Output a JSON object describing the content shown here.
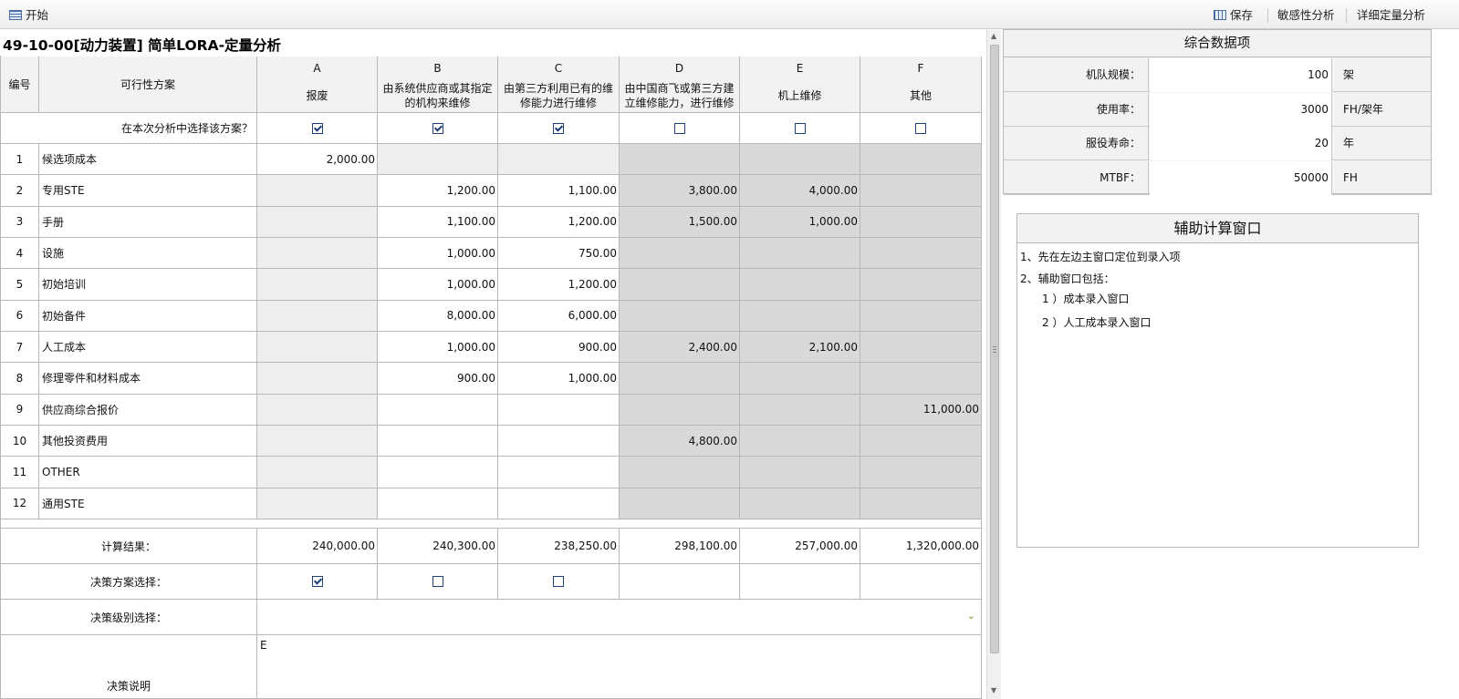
{
  "toolbar": {
    "start_label": "开始",
    "save_label": "保存",
    "sensitivity_label": "敏感性分析",
    "detail_label": "详细定量分析"
  },
  "page_title": "49-10-00[动力装置] 简单LORA-定量分析",
  "table": {
    "col_no_header": "编号",
    "col_option_header": "可行性方案",
    "columns": [
      {
        "letter": "A",
        "desc": "报废"
      },
      {
        "letter": "B",
        "desc": "由系统供应商或其指定的机构来维修"
      },
      {
        "letter": "C",
        "desc": "由第三方利用已有的维修能力进行维修"
      },
      {
        "letter": "D",
        "desc": "由中国商飞或第三方建立维修能力，进行维修"
      },
      {
        "letter": "E",
        "desc": "机上维修"
      },
      {
        "letter": "F",
        "desc": "其他"
      }
    ],
    "select_question": "在本次分析中选择该方案？",
    "select_checked": [
      true,
      true,
      true,
      false,
      false,
      false
    ],
    "rows": [
      {
        "no": "1",
        "name": "候选项成本",
        "values": [
          "2,000.00",
          "",
          "",
          "",
          "",
          ""
        ]
      },
      {
        "no": "2",
        "name": "专用STE",
        "values": [
          "",
          "1,200.00",
          "1,100.00",
          "3,800.00",
          "4,000.00",
          ""
        ]
      },
      {
        "no": "3",
        "name": "手册",
        "values": [
          "",
          "1,100.00",
          "1,200.00",
          "1,500.00",
          "1,000.00",
          ""
        ]
      },
      {
        "no": "4",
        "name": "设施",
        "values": [
          "",
          "1,000.00",
          "750.00",
          "",
          "",
          ""
        ]
      },
      {
        "no": "5",
        "name": "初始培训",
        "values": [
          "",
          "1,000.00",
          "1,200.00",
          "",
          "",
          ""
        ]
      },
      {
        "no": "6",
        "name": "初始备件",
        "values": [
          "",
          "8,000.00",
          "6,000.00",
          "",
          "",
          ""
        ]
      },
      {
        "no": "7",
        "name": "人工成本",
        "values": [
          "",
          "1,000.00",
          "900.00",
          "2,400.00",
          "2,100.00",
          ""
        ]
      },
      {
        "no": "8",
        "name": "修理零件和材料成本",
        "values": [
          "",
          "900.00",
          "1,000.00",
          "",
          "",
          ""
        ]
      },
      {
        "no": "9",
        "name": "供应商综合报价",
        "values": [
          "",
          "",
          "",
          "",
          "",
          "11,000.00"
        ]
      },
      {
        "no": "10",
        "name": "其他投资费用",
        "values": [
          "",
          "",
          "",
          "4,800.00",
          "",
          ""
        ]
      },
      {
        "no": "11",
        "name": "OTHER",
        "values": [
          "",
          "",
          "",
          "",
          "",
          ""
        ]
      },
      {
        "no": "12",
        "name": "通用STE",
        "values": [
          "",
          "",
          "",
          "",
          "",
          ""
        ]
      }
    ],
    "result_label": "计算结果：",
    "results": [
      "240,000.00",
      "240,300.00",
      "238,250.00",
      "298,100.00",
      "257,000.00",
      "1,320,000.00"
    ],
    "decision_label": "决策方案选择：",
    "decision_checks": [
      true,
      false,
      false
    ],
    "level_label": "决策级别选择：",
    "level_value": "",
    "explain_label": "决策说明",
    "explain_value": "E"
  },
  "summary": {
    "title": "综合数据项",
    "items": [
      {
        "label": "机队规模：",
        "value": "100",
        "unit": "架"
      },
      {
        "label": "使用率：",
        "value": "3000",
        "unit": "FH/架年"
      },
      {
        "label": "服役寿命：",
        "value": "20",
        "unit": "年"
      },
      {
        "label": "MTBF：",
        "value": "50000",
        "unit": "FH"
      }
    ]
  },
  "helper": {
    "title": "辅助计算窗口",
    "lines": [
      "1、先在左边主窗口定位到录入项",
      "2、辅助窗口包括：",
      "1 ）成本录入窗口",
      "2 ）人工成本录入窗口"
    ]
  },
  "colors": {
    "header_bg": "#f2f2f2",
    "light_gray": "#eeeeee",
    "dark_gray": "#d9d9d9",
    "checkbox": "#1f3f78"
  }
}
